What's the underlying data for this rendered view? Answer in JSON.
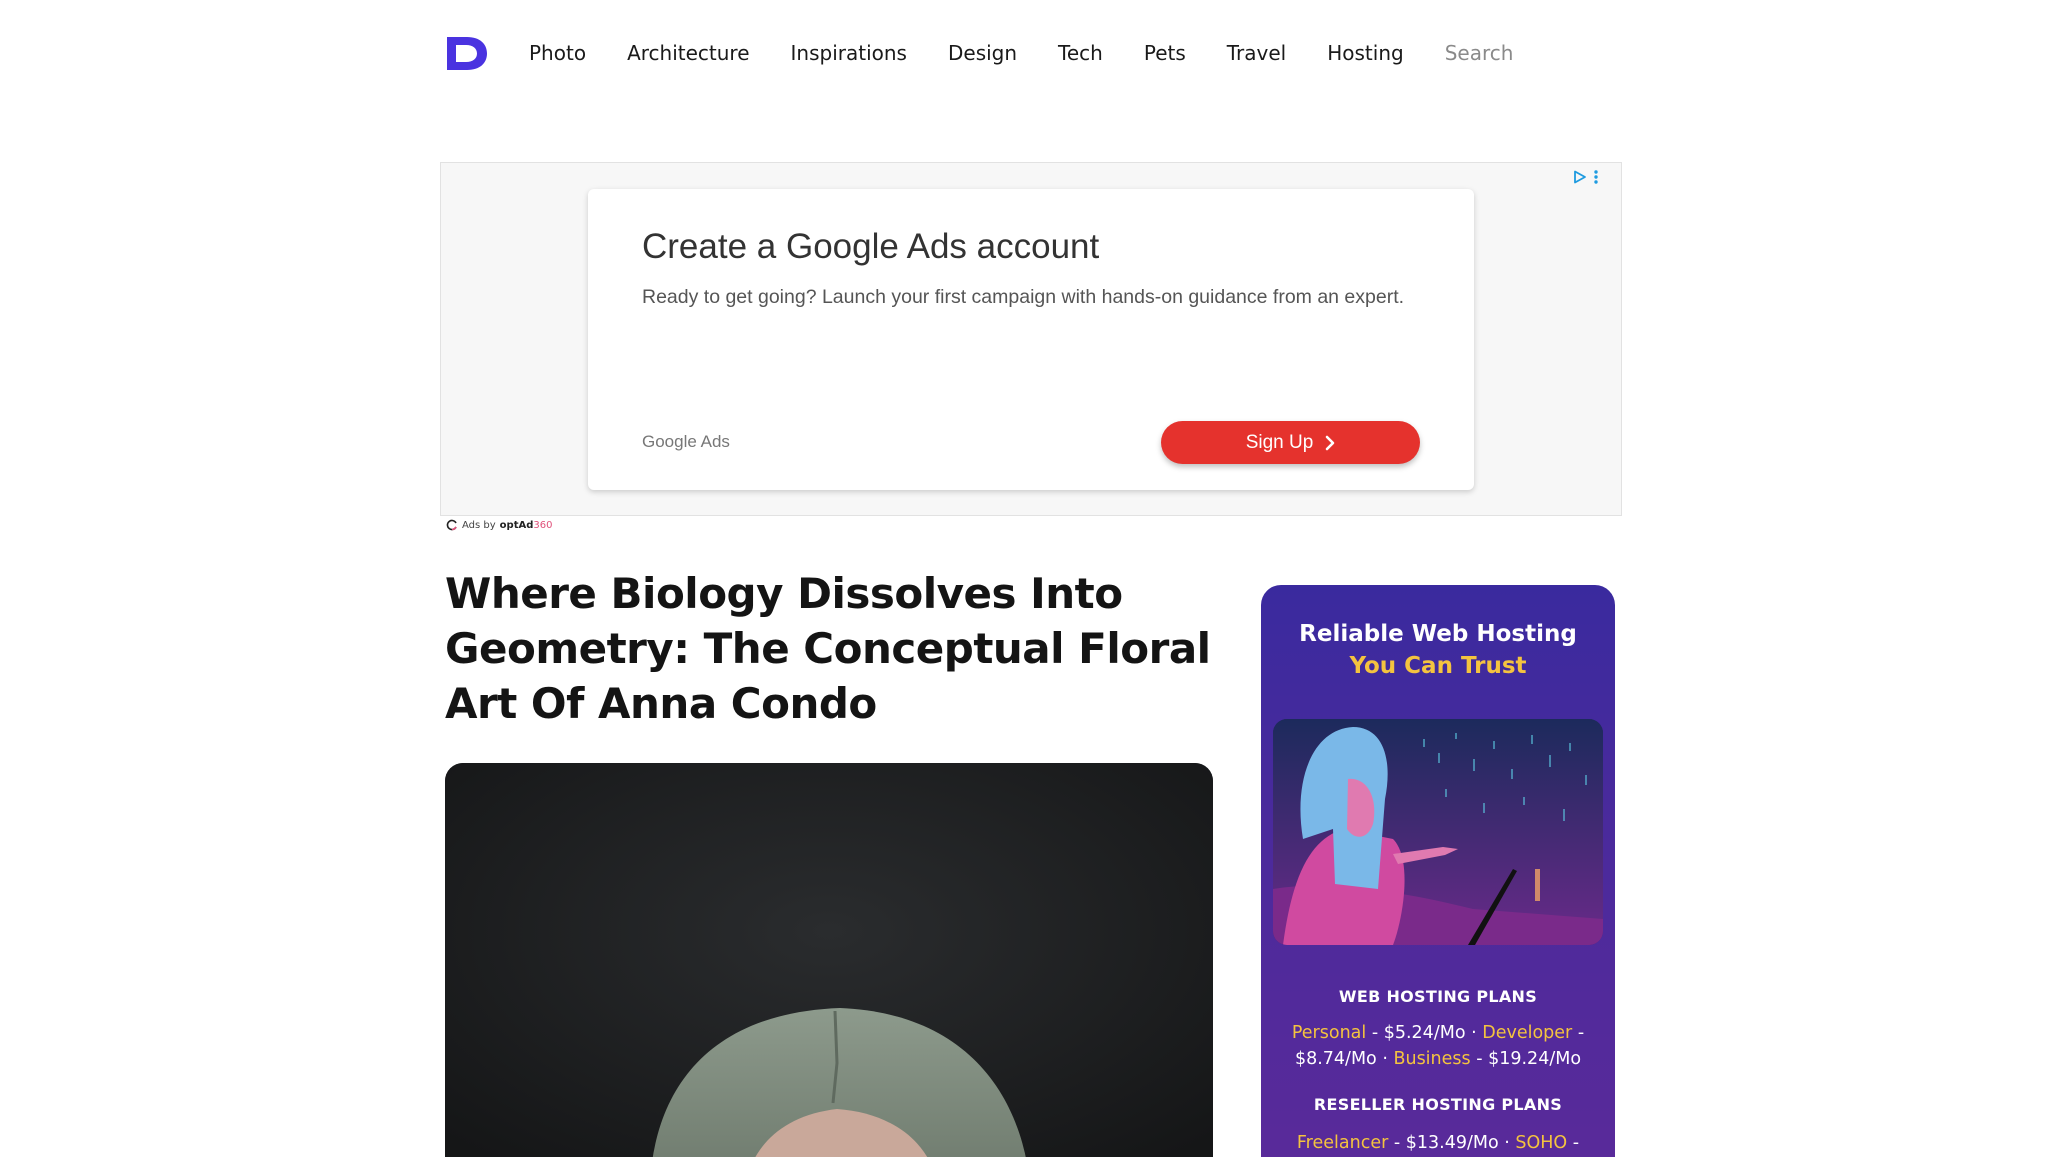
{
  "nav": {
    "items": [
      "Photo",
      "Architecture",
      "Inspirations",
      "Design",
      "Tech",
      "Pets",
      "Travel",
      "Hosting"
    ],
    "search_label": "Search"
  },
  "ad": {
    "title": "Create a Google Ads account",
    "description": "Ready to get going? Launch your first campaign with hands-on guidance from an expert.",
    "brand": "Google Ads",
    "cta": "Sign Up",
    "byline_prefix": "Ads by",
    "byline_brand": "optAd",
    "byline_num": "360"
  },
  "article": {
    "title": "Where Biology Dissolves Into Geometry: The Conceptual Floral Art Of Anna Condo"
  },
  "hosting_ad": {
    "headline": "Reliable Web Hosting",
    "subheadline": "You Can Trust",
    "web_section": "WEB HOSTING PLANS",
    "web_plans": [
      {
        "name": "Personal",
        "price": "$5.24/Mo"
      },
      {
        "name": "Developer",
        "price": "$8.74/Mo"
      },
      {
        "name": "Business",
        "price": "$19.24/Mo"
      }
    ],
    "reseller_section": "RESELLER HOSTING PLANS",
    "reseller_plans": [
      {
        "name": "Freelancer",
        "price": "$13.49/Mo"
      },
      {
        "name": "SOHO",
        "price": ""
      }
    ]
  },
  "colors": {
    "logo": "#4a33e0",
    "ad_cta": "#e5322d",
    "hosting_bg": "#4a2a9c",
    "hosting_gold": "#f4c33f"
  },
  "icons": [
    "logo-d-icon",
    "adchoices-icon",
    "ad-menu-dots-icon",
    "chevron-right-icon",
    "optad-ring-icon"
  ]
}
